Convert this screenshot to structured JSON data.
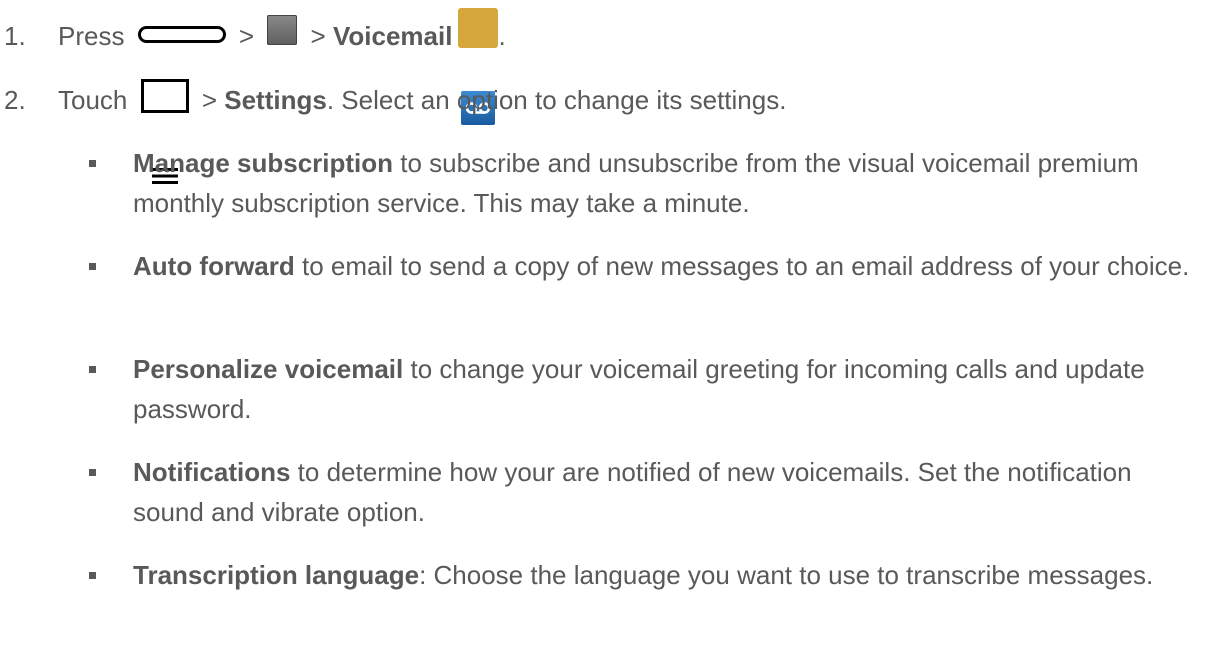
{
  "steps": [
    {
      "number": "1.",
      "press": "Press ",
      "sep1": " > ",
      "sep2": " > ",
      "target": "Voicemail",
      "end": ".",
      "icons": [
        "home-key-icon",
        "apps-grid-icon",
        "voicemail-app-icon"
      ]
    },
    {
      "number": "2.",
      "touch": "Touch ",
      "sep": " > ",
      "target": "Settings",
      "rest": ". Select an option to change its settings.",
      "icons": [
        "menu-key-icon"
      ]
    }
  ],
  "options": [
    {
      "term": "Manage subscription",
      "desc": " to subscribe and unsubscribe from the visual voicemail premium monthly subscription service. This may take a minute."
    },
    {
      "term": "Auto forward",
      "desc": " to email to send a copy of new messages to an email address of your choice."
    },
    {
      "term": "Personalize voicemail",
      "desc": " to change your voicemail greeting for incoming calls and update password."
    },
    {
      "term": "Notifications",
      "desc": " to determine how your are notified of new voicemails. Set the notification sound and vibrate option."
    },
    {
      "term": "Transcription language",
      "desc": ": Choose the language you want to use to transcribe messages."
    }
  ],
  "colors": {
    "text": "#595959",
    "voicemail_icon_border": "#d6a73a",
    "voicemail_icon_fill": "#2a6fb8"
  }
}
